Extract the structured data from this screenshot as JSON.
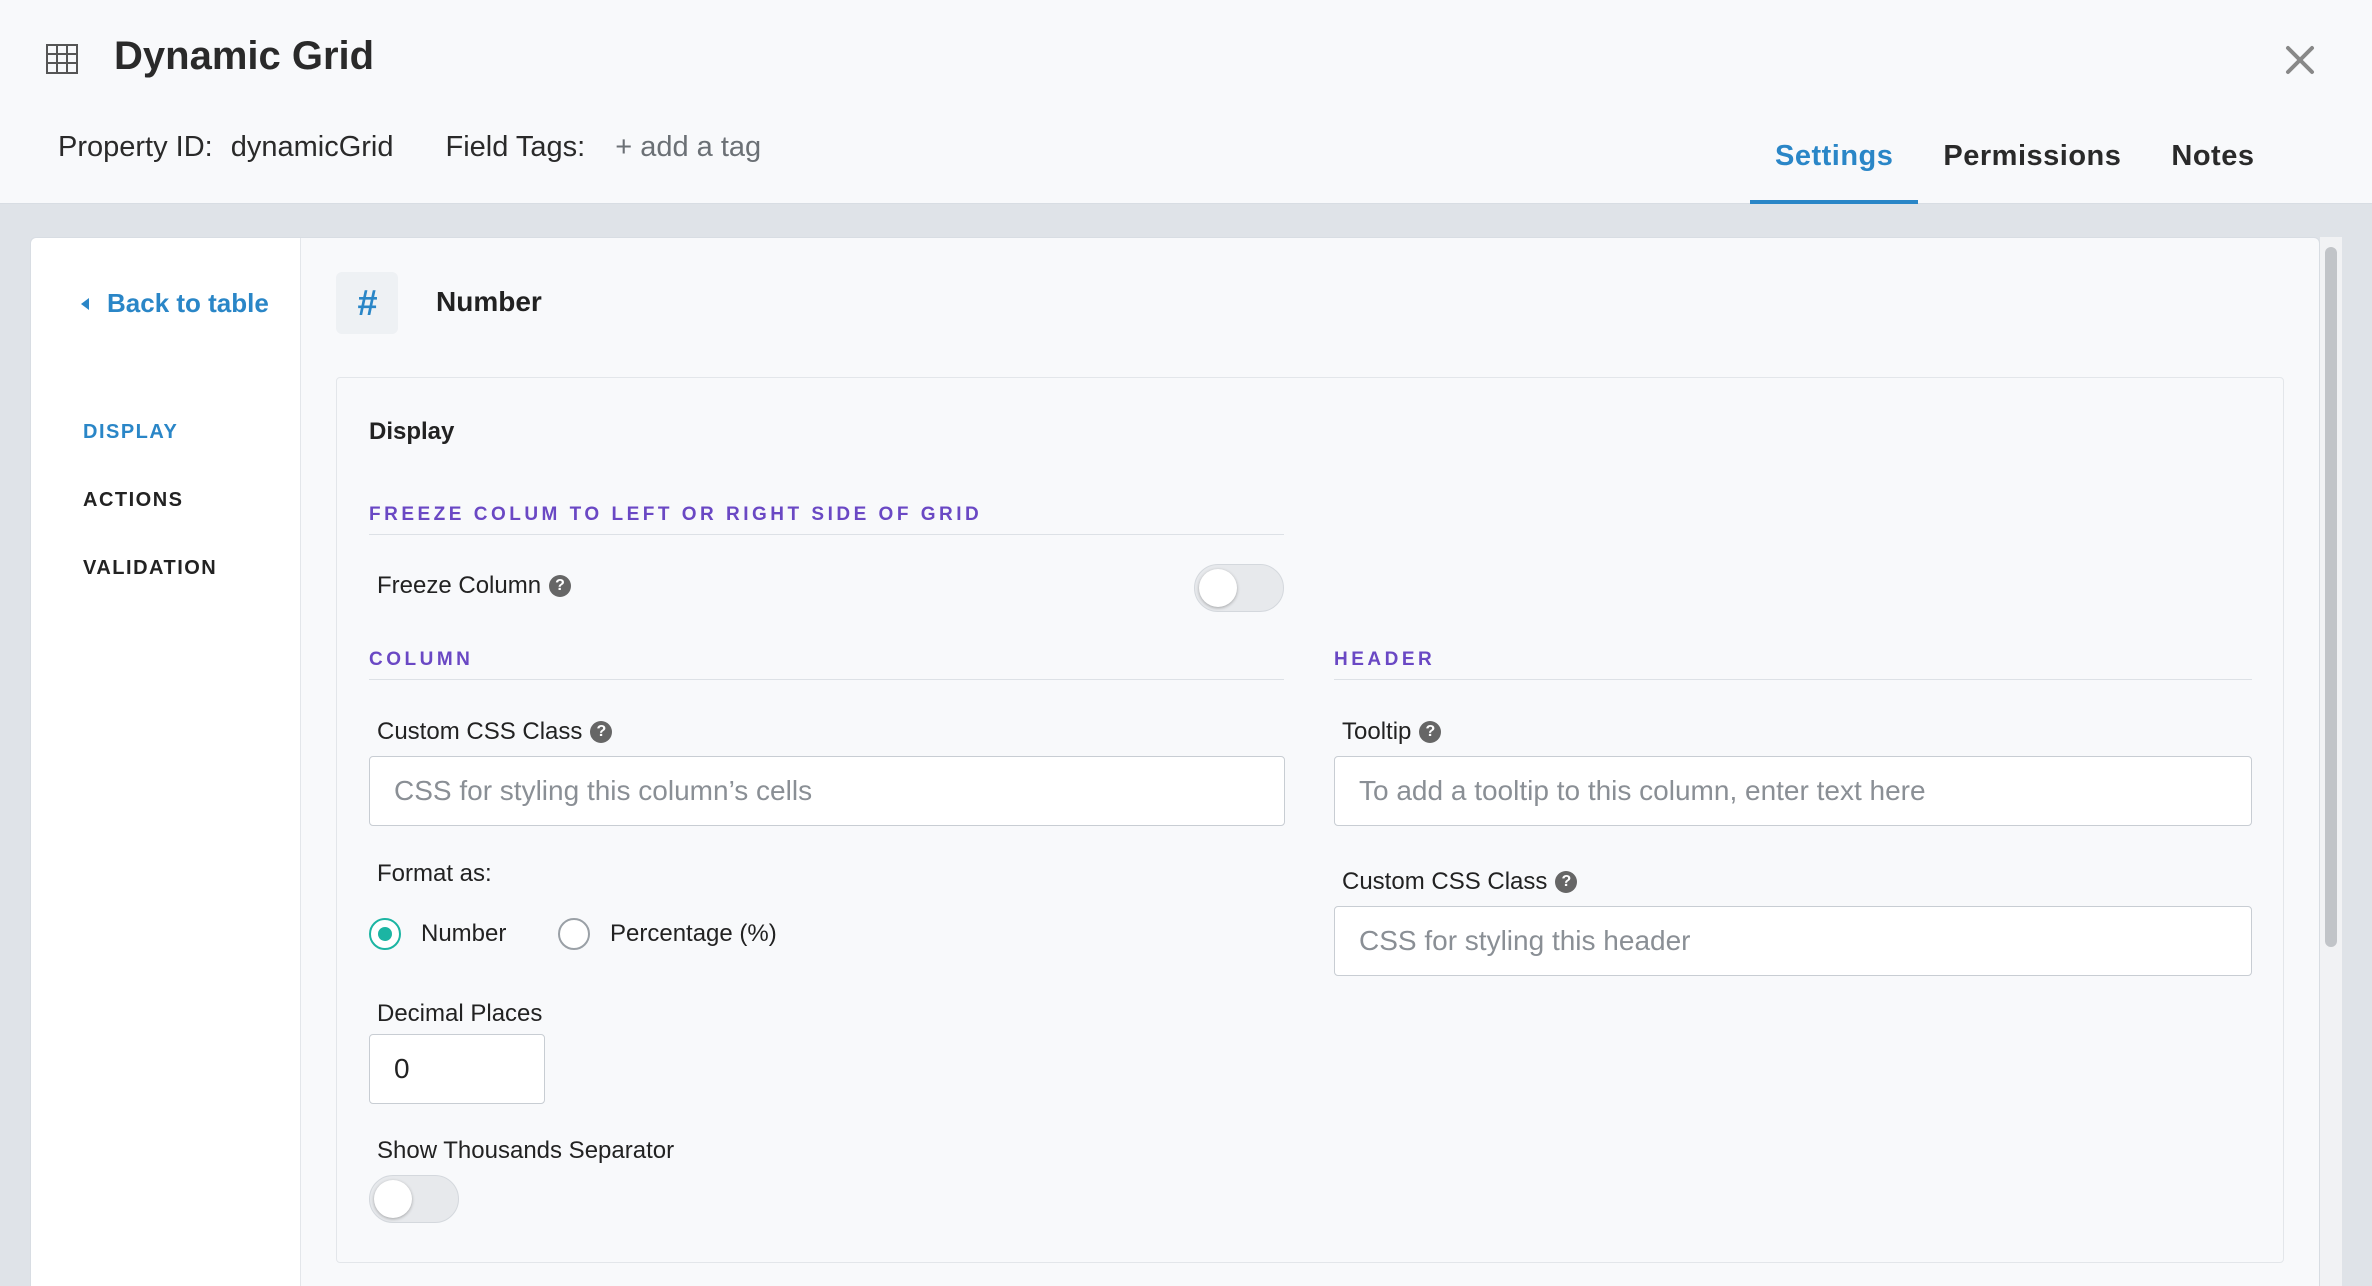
{
  "header": {
    "icon": "table-grid-icon",
    "title": "Dynamic Grid",
    "property_id_label": "Property ID:",
    "property_id_value": "dynamicGrid",
    "field_tags_label": "Field Tags:",
    "add_tag": "+ add a tag",
    "close_icon": "close-icon"
  },
  "tabs": [
    {
      "label": "Settings",
      "active": true
    },
    {
      "label": "Permissions",
      "active": false
    },
    {
      "label": "Notes",
      "active": false
    }
  ],
  "sidebar": {
    "back_label": "Back to table",
    "items": [
      {
        "label": "DISPLAY",
        "active": true
      },
      {
        "label": "ACTIONS",
        "active": false
      },
      {
        "label": "VALIDATION",
        "active": false
      }
    ]
  },
  "column": {
    "type_icon": "#",
    "type_name": "Number"
  },
  "display": {
    "title": "Display",
    "freeze_section": "FREEZE COLUM TO LEFT OR RIGHT SIDE OF GRID",
    "freeze_label": "Freeze Column",
    "freeze_on": false,
    "column_section": "COLUMN",
    "header_section": "HEADER",
    "column_css_label": "Custom CSS Class",
    "column_css_placeholder": "CSS for styling this column’s cells",
    "format_label": "Format as:",
    "format_options": [
      {
        "label": "Number",
        "checked": true
      },
      {
        "label": "Percentage (%)",
        "checked": false
      }
    ],
    "decimal_label": "Decimal Places",
    "decimal_value": "0",
    "thousands_label": "Show Thousands Separator",
    "thousands_on": false,
    "tooltip_label": "Tooltip",
    "tooltip_placeholder": "To add a tooltip to this column, enter text here",
    "header_css_label": "Custom CSS Class",
    "header_css_placeholder": "CSS for styling this header"
  },
  "colors": {
    "accent": "#2a86c7",
    "section_heading": "#6a48c4",
    "radio_checked": "#1cb5a3"
  }
}
